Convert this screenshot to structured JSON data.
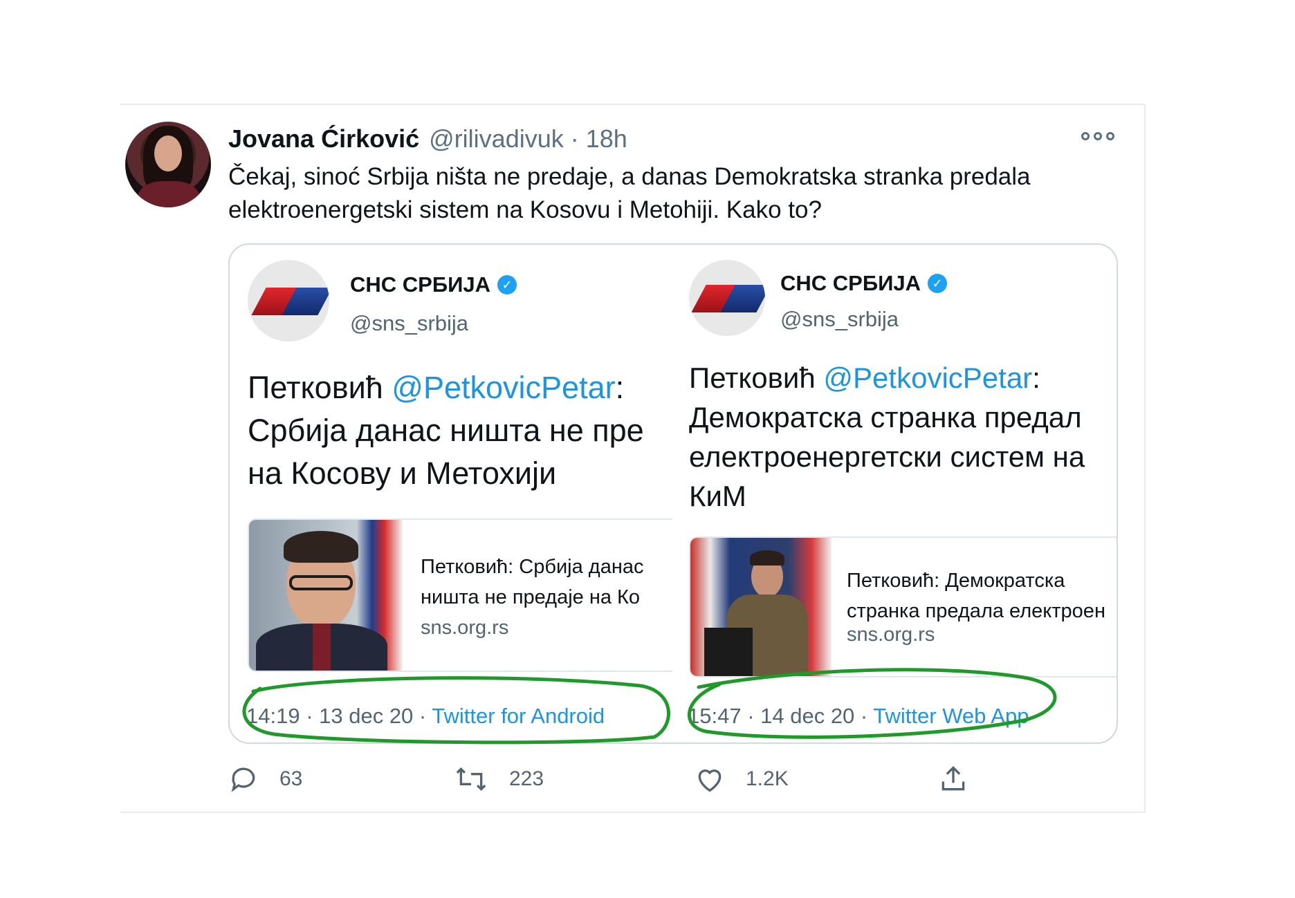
{
  "tweet": {
    "author_name": "Jovana Ćirković",
    "author_handle": "@rilivadivuk",
    "separator": "·",
    "time": "18h",
    "text_line1": "Čekaj, sinoć Srbija ništa ne predaje, a danas Demokratska stranka predala",
    "text_line2": "elektroenergetski sistem na Kosovu i Metohiji. Kako to?"
  },
  "embeds": [
    {
      "org_name": "СНС СРБИЈА",
      "org_handle": "@sns_srbija",
      "text_prefix": "Петковић ",
      "mention": "@PetkovicPetar",
      "text_suffix": ":",
      "text_line2": "Србија данас ништа не пре",
      "text_line3": "на Косову и Метохији",
      "link_title_line1": "Петковић: Србија данас",
      "link_title_line2": "ништа не предаје на Ко",
      "link_domain": "sns.org.rs",
      "meta_time": "14:19 · 13 dec 20 · ",
      "meta_source": "Twitter for Android"
    },
    {
      "org_name": "СНС СРБИЈА",
      "org_handle": "@sns_srbija",
      "text_prefix": "Петковић ",
      "mention": "@PetkovicPetar",
      "text_suffix": ":",
      "text_line2": "Демократска странка предал",
      "text_line3": "електроенергетски систем на",
      "text_line4": "КиМ",
      "link_title_line1": "Петковић: Демократска",
      "link_title_line2": "странка предала електроен",
      "link_domain": "sns.org.rs",
      "meta_time": "15:47 · 14 dec 20 · ",
      "meta_source": "Twitter Web App"
    }
  ],
  "actions": {
    "reply_icon": "reply-icon",
    "reply_count": "63",
    "retweet_icon": "retweet-icon",
    "retweet_count": "223",
    "like_icon": "heart-icon",
    "like_count": "1.2K",
    "share_icon": "share-icon"
  },
  "colors": {
    "link_blue": "#1b95e0",
    "secondary_text": "#5b7083",
    "annotation_green": "#1f9a2a"
  }
}
